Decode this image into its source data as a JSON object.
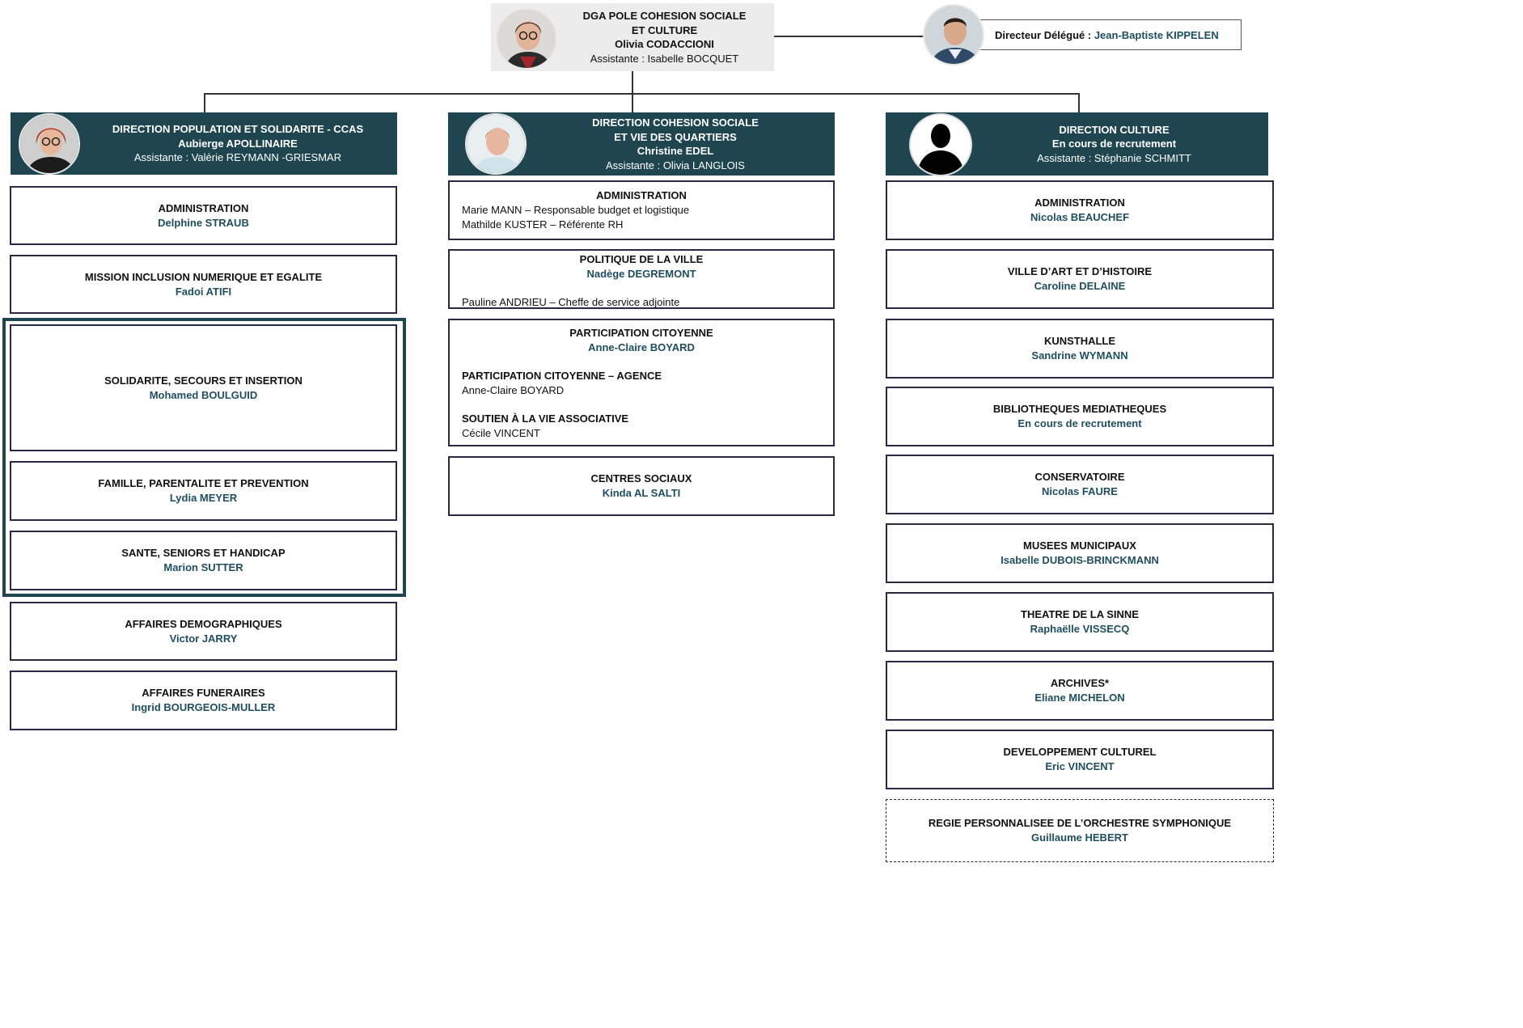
{
  "dga": {
    "line1": "DGA POLE COHESION SOCIALE",
    "line2": "ET CULTURE",
    "name": "Olivia CODACCIONI",
    "assistant": "Assistante  : Isabelle BOCQUET"
  },
  "delegate": {
    "label": "Directeur Délégué : ",
    "name": "Jean-Baptiste KIPPELEN"
  },
  "columns": {
    "population": {
      "title": "DIRECTION POPULATION ET SOLIDARITE - CCAS",
      "name": "Aubierge APOLLINAIRE",
      "assistant": "Assistante : Valérie REYMANN -GRIESMAR",
      "units": [
        {
          "title": "ADMINISTRATION",
          "name": "Delphine STRAUB"
        },
        {
          "title": "MISSION INCLUSION NUMERIQUE ET EGALITE",
          "name": "Fadoi ATIFI"
        },
        {
          "title": "SOLIDARITE, SECOURS ET INSERTION",
          "name": "Mohamed BOULGUID"
        },
        {
          "title": "FAMILLE, PARENTALITE ET PREVENTION",
          "name": "Lydia MEYER"
        },
        {
          "title": "SANTE, SENIORS ET HANDICAP",
          "name": "Marion SUTTER"
        },
        {
          "title": "AFFAIRES DEMOGRAPHIQUES",
          "name": "Victor JARRY"
        },
        {
          "title": "AFFAIRES FUNERAIRES",
          "name": "Ingrid BOURGEOIS-MULLER"
        }
      ]
    },
    "cohesion": {
      "line1": "DIRECTION COHESION SOCIALE",
      "line2": "ET VIE DES QUARTIERS",
      "name": "Christine EDEL",
      "assistant": "Assistante : Olivia LANGLOIS",
      "admin": {
        "title": "ADMINISTRATION",
        "line1": "Marie MANN – Responsable budget et logistique",
        "line2": "Mathilde KUSTER – Référente RH"
      },
      "politique": {
        "title": "POLITIQUE DE LA VILLE",
        "name": "Nadège DEGREMONT",
        "deputy": "Pauline ANDRIEU – Cheffe de service adjointe"
      },
      "participation": {
        "title": "PARTICIPATION CITOYENNE",
        "name": "Anne-Claire BOYARD",
        "agence_title": "PARTICIPATION CITOYENNE – AGENCE",
        "agence_name": "Anne-Claire BOYARD",
        "asso_title": "SOUTIEN À LA VIE ASSOCIATIVE",
        "asso_name": "Cécile VINCENT"
      },
      "centres": {
        "title": "CENTRES SOCIAUX",
        "name": "Kinda AL SALTI"
      }
    },
    "culture": {
      "title": "DIRECTION CULTURE",
      "name": "En cours de recrutement",
      "assistant": "Assistante : Stéphanie SCHMITT",
      "units": [
        {
          "title": "ADMINISTRATION",
          "name": "Nicolas BEAUCHEF"
        },
        {
          "title": "VILLE D’ART ET D’HISTOIRE",
          "name": "Caroline DELAINE"
        },
        {
          "title": "KUNSTHALLE",
          "name": "Sandrine WYMANN"
        },
        {
          "title": "BIBLIOTHEQUES MEDIATHEQUES",
          "name": "En cours de recrutement"
        },
        {
          "title": "CONSERVATOIRE",
          "name": "Nicolas FAURE"
        },
        {
          "title": "MUSEES MUNICIPAUX",
          "name": "Isabelle DUBOIS-BRINCKMANN"
        },
        {
          "title": "THEATRE DE LA SINNE",
          "name": "Raphaëlle VISSECQ"
        },
        {
          "title": "ARCHIVES*",
          "name": "Eliane MICHELON"
        },
        {
          "title": "DEVELOPPEMENT CULTUREL",
          "name": "Eric VINCENT"
        },
        {
          "title": "REGIE PERSONNALISEE DE L’ORCHESTRE SYMPHONIQUE",
          "name": "Guillaume HEBERT"
        }
      ]
    }
  },
  "colors": {
    "header_bg": "#1f4650",
    "name_text": "#1f4e5f",
    "card_border": "#2c2745",
    "group_border": "#1f4650",
    "top_box_bg": "#ececec"
  },
  "icons": [
    "portrait-photo",
    "placeholder-silhouette-icon"
  ]
}
